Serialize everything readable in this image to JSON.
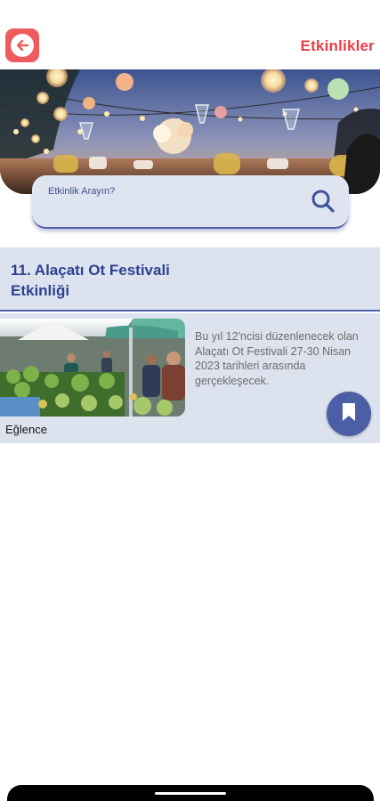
{
  "header": {
    "title": "Etkinlikler",
    "back_icon": "arrow-left-icon",
    "accent_color": "#ea3d43"
  },
  "search": {
    "placeholder": "Etkinlik Arayın?",
    "icon": "search-icon"
  },
  "section": {
    "title": "11. Alaçatı Ot Festivali\n Etkinliği"
  },
  "event": {
    "description": "Bu yıl 12'ncisi düzenlenecek olan Alaçatı Ot Festivali 27-30 Nisan 2023 tarihleri arasında gerçekleşecek.",
    "category": "Eğlence",
    "bookmark_icon": "bookmark-icon",
    "brand_color": "#4c5fa6"
  }
}
